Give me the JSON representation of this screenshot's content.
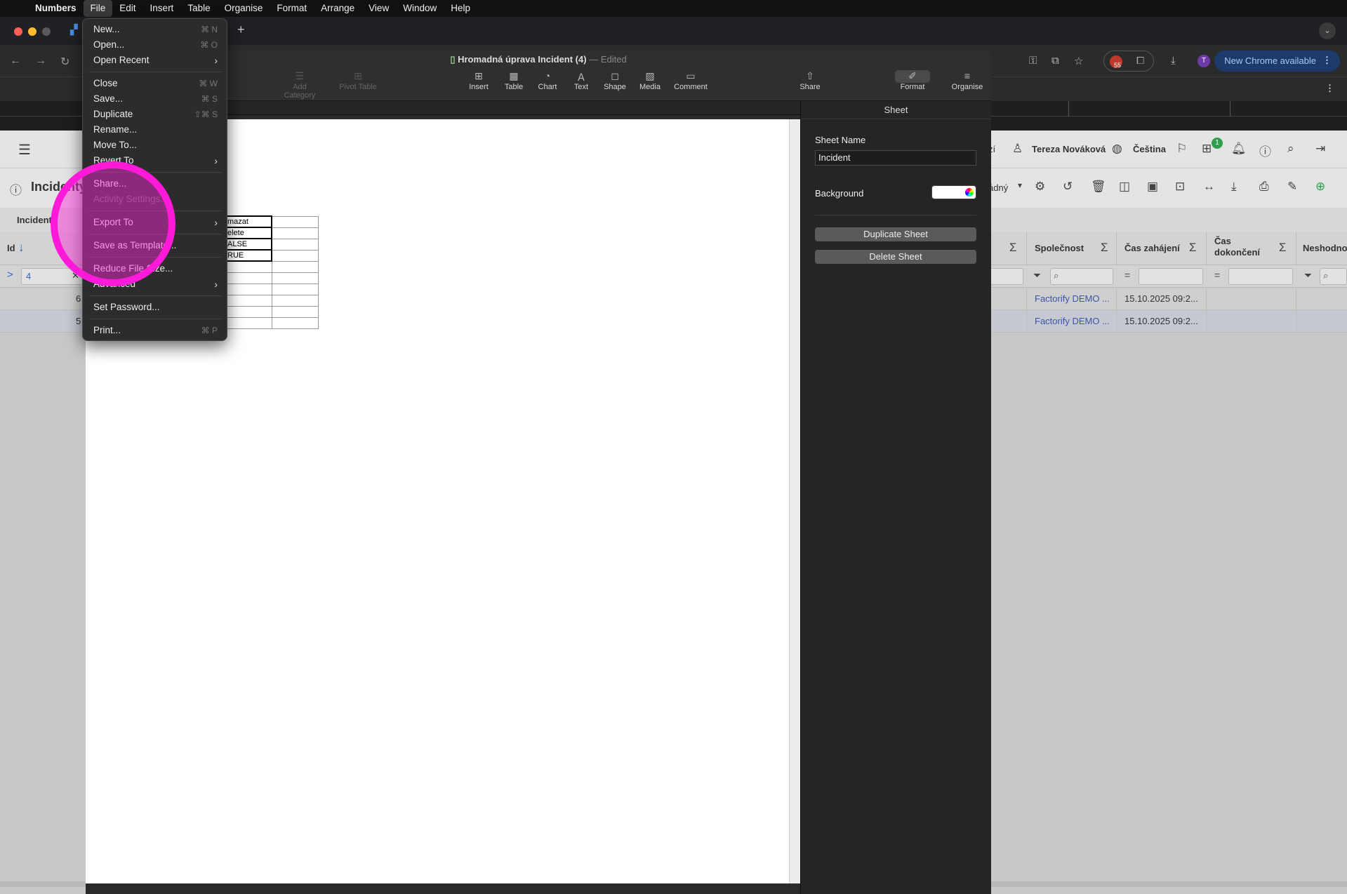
{
  "menubar": {
    "app": "Numbers",
    "items": [
      "File",
      "Edit",
      "Insert",
      "Table",
      "Organise",
      "Format",
      "Arrange",
      "View",
      "Window",
      "Help"
    ],
    "active": "File"
  },
  "chrome": {
    "new_chrome_label": "New Chrome available",
    "extension_badge": "55",
    "avatar_letter": "T"
  },
  "numbers": {
    "doc_title": "Hromadná úprava Incident (4)",
    "edited_label": "— Edited",
    "toolbar": [
      "Add Category",
      "Pivot Table",
      "Insert",
      "Table",
      "Chart",
      "Text",
      "Shape",
      "Media",
      "Comment",
      "Share",
      "Format",
      "Organise"
    ],
    "grid_cells": [
      "mazat",
      "elete",
      "ALSE",
      "RUE"
    ],
    "panel": {
      "header": "Sheet",
      "sheet_name_label": "Sheet Name",
      "sheet_name_value": "Incident",
      "background_label": "Background",
      "duplicate_label": "Duplicate Sheet",
      "delete_label": "Delete Sheet"
    }
  },
  "file_menu": {
    "new": "New...",
    "new_sc": "⌘ N",
    "open": "Open...",
    "open_sc": "⌘ O",
    "open_recent": "Open Recent",
    "close": "Close",
    "close_sc": "⌘ W",
    "save": "Save...",
    "save_sc": "⌘ S",
    "duplicate": "Duplicate",
    "duplicate_sc": "⇧⌘ S",
    "rename": "Rename...",
    "move_to": "Move To...",
    "revert_to": "Revert To",
    "share": "Share...",
    "activity": "Activity Settings...",
    "export_to": "Export To",
    "save_template": "Save as Template...",
    "reduce": "Reduce File Size...",
    "advanced": "Advanced",
    "set_password": "Set Password...",
    "print": "Print...",
    "print_sc": "⌘ P"
  },
  "webapp": {
    "page_title": "Incidenty",
    "tab_label": "Incident",
    "user_name": "Tereza Nováková",
    "language": "Čeština",
    "notif_count": "1",
    "fragment_zi": "zí",
    "fragment_adny": "ádný",
    "col_id": "Id",
    "col_company": "Společnost",
    "col_start": "Čas zahájení",
    "col_end_1": "Čas",
    "col_end_2": "dokončení",
    "col_nonconf": "Neshodno",
    "filter_id": "4",
    "rows": [
      {
        "id": "6",
        "company": "Factorify DEMO ...",
        "start": "15.10.2025 09:2..."
      },
      {
        "id": "5",
        "company": "Factorify DEMO ...",
        "start": "15.10.2025 09:2..."
      }
    ]
  },
  "colors": {
    "highlight": "#ff1ad9",
    "chrome_blue": "#1c3a6b"
  }
}
